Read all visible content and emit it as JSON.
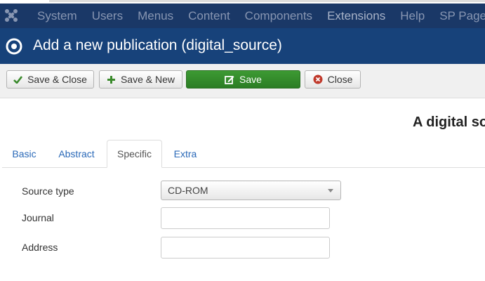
{
  "navbar": {
    "logo_icon": "joomla-logo-icon",
    "items": [
      "System",
      "Users",
      "Menus",
      "Content",
      "Components",
      "Extensions",
      "Help",
      "SP Page"
    ]
  },
  "header": {
    "icon": "target-circle-icon",
    "title": "Add a new publication (digital_source)"
  },
  "toolbar": {
    "save_close_label": "Save & Close",
    "save_new_label": "Save & New",
    "save_label": "Save",
    "close_label": "Close",
    "accent_green": "#2f8a27",
    "close_icon_color": "#c0392b"
  },
  "page_heading": "A digital so",
  "tabs": [
    {
      "label": "Basic",
      "active": false
    },
    {
      "label": "Abstract",
      "active": false
    },
    {
      "label": "Specific",
      "active": true
    },
    {
      "label": "Extra",
      "active": false
    }
  ],
  "form": {
    "source_type_label": "Source type",
    "source_type_value": "CD-ROM",
    "journal_label": "Journal",
    "journal_value": "",
    "address_label": "Address",
    "address_value": ""
  },
  "colors": {
    "navbar_bg": "#1a3867",
    "header_bg": "#17427a",
    "link": "#2a69b8"
  }
}
